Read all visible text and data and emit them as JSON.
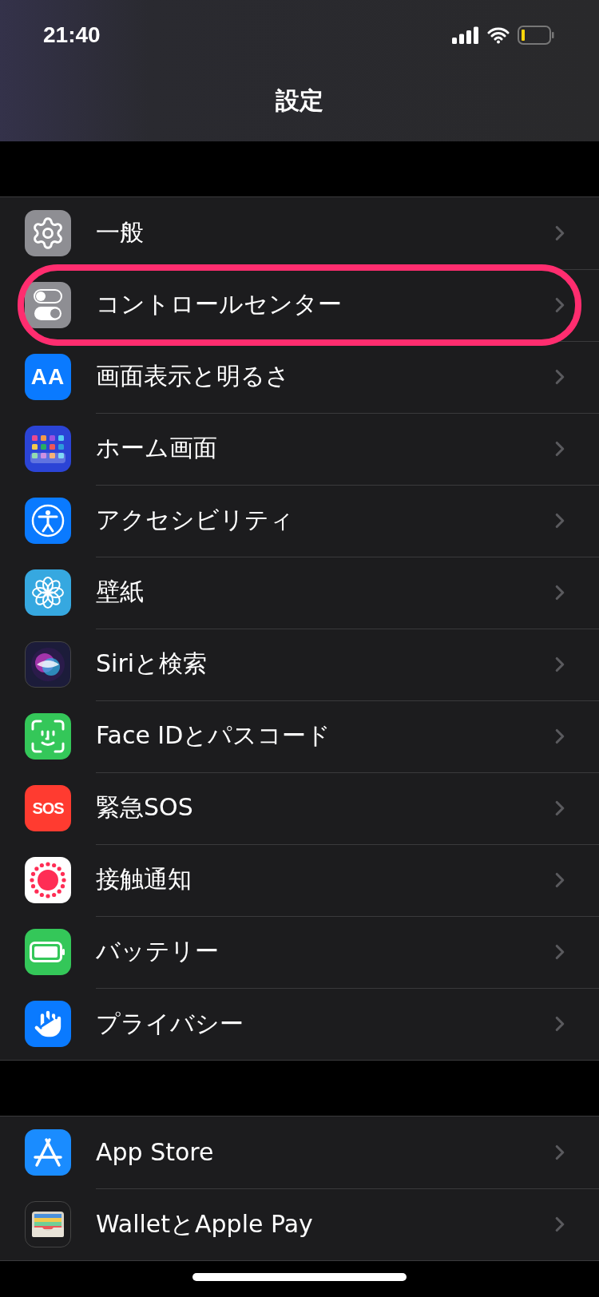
{
  "status_bar": {
    "time": "21:40"
  },
  "nav": {
    "title": "設定"
  },
  "groups": [
    {
      "items": [
        {
          "label": "一般",
          "kind": "gear",
          "color": "#8e8e93",
          "highlighted": false
        },
        {
          "label": "コントロールセンター",
          "kind": "toggles",
          "color": "#8e8e93",
          "highlighted": true
        },
        {
          "label": "画面表示と明るさ",
          "kind": "text",
          "icon_text": "AA",
          "color": "#0a7aff",
          "highlighted": false
        },
        {
          "label": "ホーム画面",
          "kind": "grid",
          "color": "#2b44d6",
          "highlighted": false
        },
        {
          "label": "アクセシビリティ",
          "kind": "person",
          "color": "#0a7aff",
          "highlighted": false
        },
        {
          "label": "壁紙",
          "kind": "flower",
          "color": "#36a8e0",
          "highlighted": false
        },
        {
          "label": "Siriと検索",
          "kind": "orb",
          "color": "#1c1c3a",
          "highlighted": false
        },
        {
          "label": "Face IDとパスコード",
          "kind": "face",
          "color": "#34c759",
          "highlighted": false
        },
        {
          "label": "緊急SOS",
          "kind": "text",
          "icon_text": "SOS",
          "color": "#ff3b30",
          "highlighted": false
        },
        {
          "label": "接触通知",
          "kind": "dots",
          "color": "#ffffff",
          "highlighted": false
        },
        {
          "label": "バッテリー",
          "kind": "battery",
          "color": "#34c759",
          "highlighted": false
        },
        {
          "label": "プライバシー",
          "kind": "hand",
          "color": "#0a7aff",
          "highlighted": false
        }
      ]
    },
    {
      "items": [
        {
          "label": "App Store",
          "kind": "appstore",
          "color": "#1a8cff",
          "highlighted": false
        },
        {
          "label": "WalletとApple Pay",
          "kind": "wallet",
          "color": "#1c1c1e",
          "highlighted": false
        }
      ]
    }
  ]
}
